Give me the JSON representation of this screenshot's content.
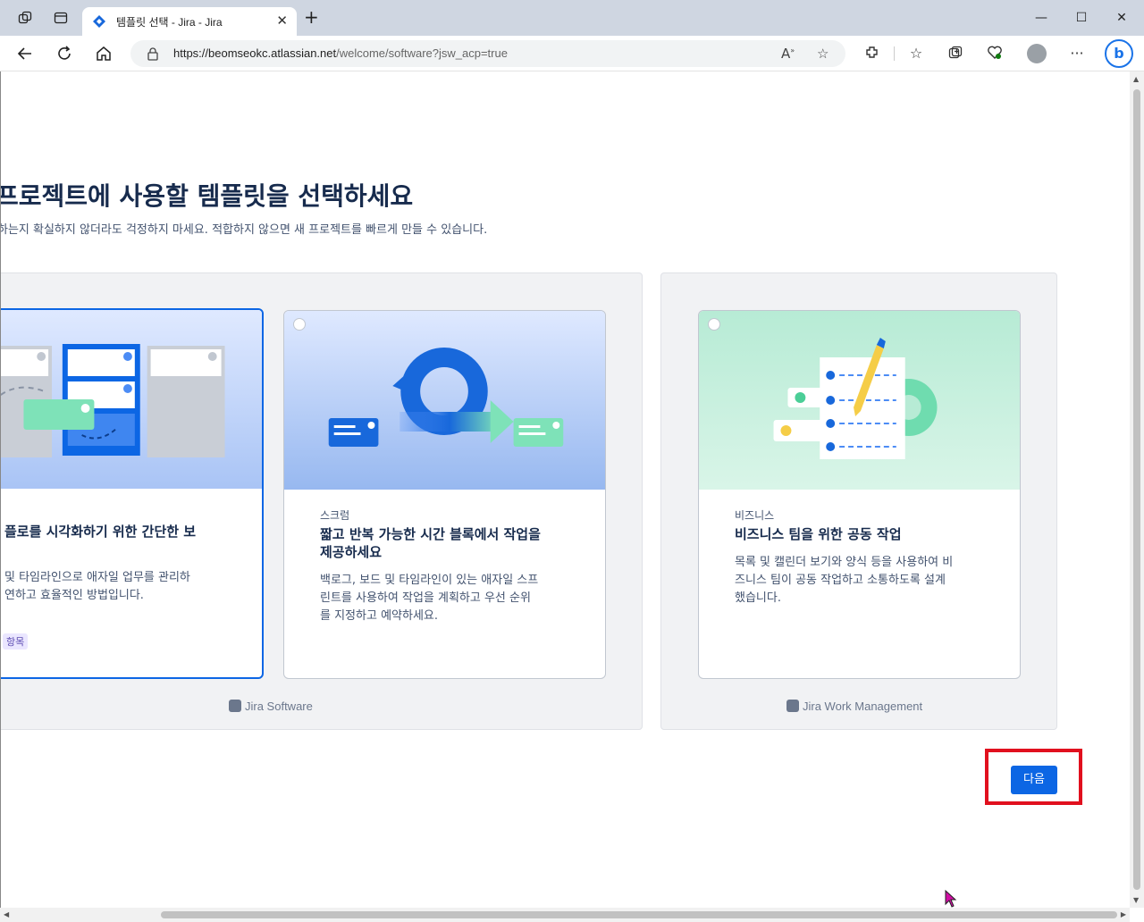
{
  "browser": {
    "tab": {
      "title": "템플릿 선택 - Jira - Jira"
    },
    "url": {
      "host": "https://beomseokc.atlassian.net",
      "path": "/welcome/software?jsw_acp=true"
    },
    "colors": {
      "accent": "#0c66e4",
      "highlight": "#e1101e"
    }
  },
  "page": {
    "heading": "프로젝트에 사용할 템플릿을 선택하세요",
    "subheading": "하는지 확실하지 않더라도 걱정하지 마세요. 적합하지 않으면 새 프로젝트를 빠르게 만들 수 있습니다.",
    "groups": [
      {
        "label": "Jira Software"
      },
      {
        "label": "Jira Work Management"
      }
    ],
    "cards": [
      {
        "category": "",
        "title": "플로를 시각화하기 위한 간단한 보",
        "desc_line1": "및 타임라인으로 애자일 업무를 관리하",
        "desc_line2": "연하고 효율적인 방법입니다.",
        "lozenge": "항목",
        "selected": true
      },
      {
        "category": "스크럼",
        "title_line1": "짧고 반복 가능한 시간 블록에서 작업을",
        "title_line2": "제공하세요",
        "desc_line1": "백로그, 보드 및 타임라인이 있는 애자일 스프",
        "desc_line2": "린트를 사용하여 작업을 계획하고 우선 순위",
        "desc_line3": "를 지정하고 예약하세요.",
        "selected": false
      },
      {
        "category": "비즈니스",
        "title": "비즈니스 팀을 위한 공동 작업",
        "desc_line1": "목록 및 캘린더 보기와 양식 등을 사용하여 비",
        "desc_line2": "즈니스 팀이 공동 작업하고 소통하도록 설계",
        "desc_line3": "했습니다.",
        "selected": false
      }
    ],
    "next_label": "다음"
  }
}
